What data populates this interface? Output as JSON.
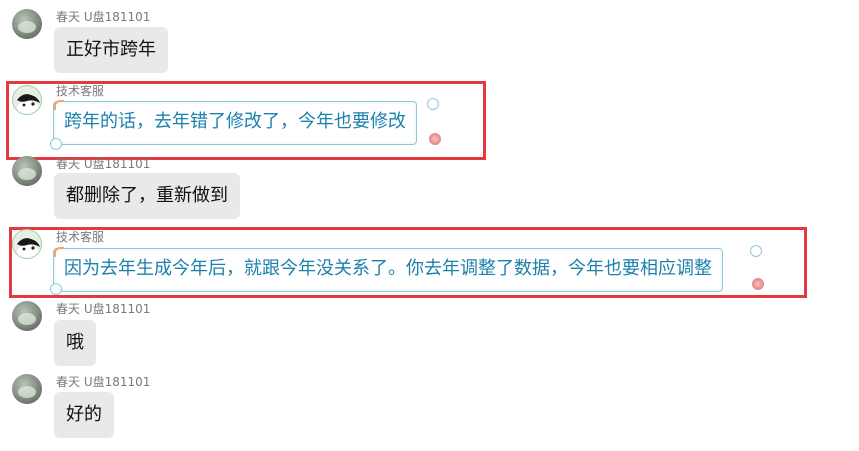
{
  "messages": [
    {
      "sender": "春天 U盘181101",
      "text": "正好市跨年",
      "role": "user"
    },
    {
      "sender": "技术客服",
      "text": "跨年的话，去年错了修改了，今年也要修改",
      "role": "support"
    },
    {
      "sender": "春天 U盘181101",
      "text": "都删除了，重新做到",
      "role": "user"
    },
    {
      "sender": "技术客服",
      "text": "因为去年生成今年后，就跟今年没关系了。你去年调整了数据，今年也要相应调整",
      "role": "support"
    },
    {
      "sender": "春天 U盘181101",
      "text": "哦",
      "role": "user"
    },
    {
      "sender": "春天 U盘181101",
      "text": "好的",
      "role": "user"
    }
  ],
  "colors": {
    "highlight": "#e5393f",
    "support_text": "#1d80ad",
    "user_bubble": "#e9e9e9"
  }
}
